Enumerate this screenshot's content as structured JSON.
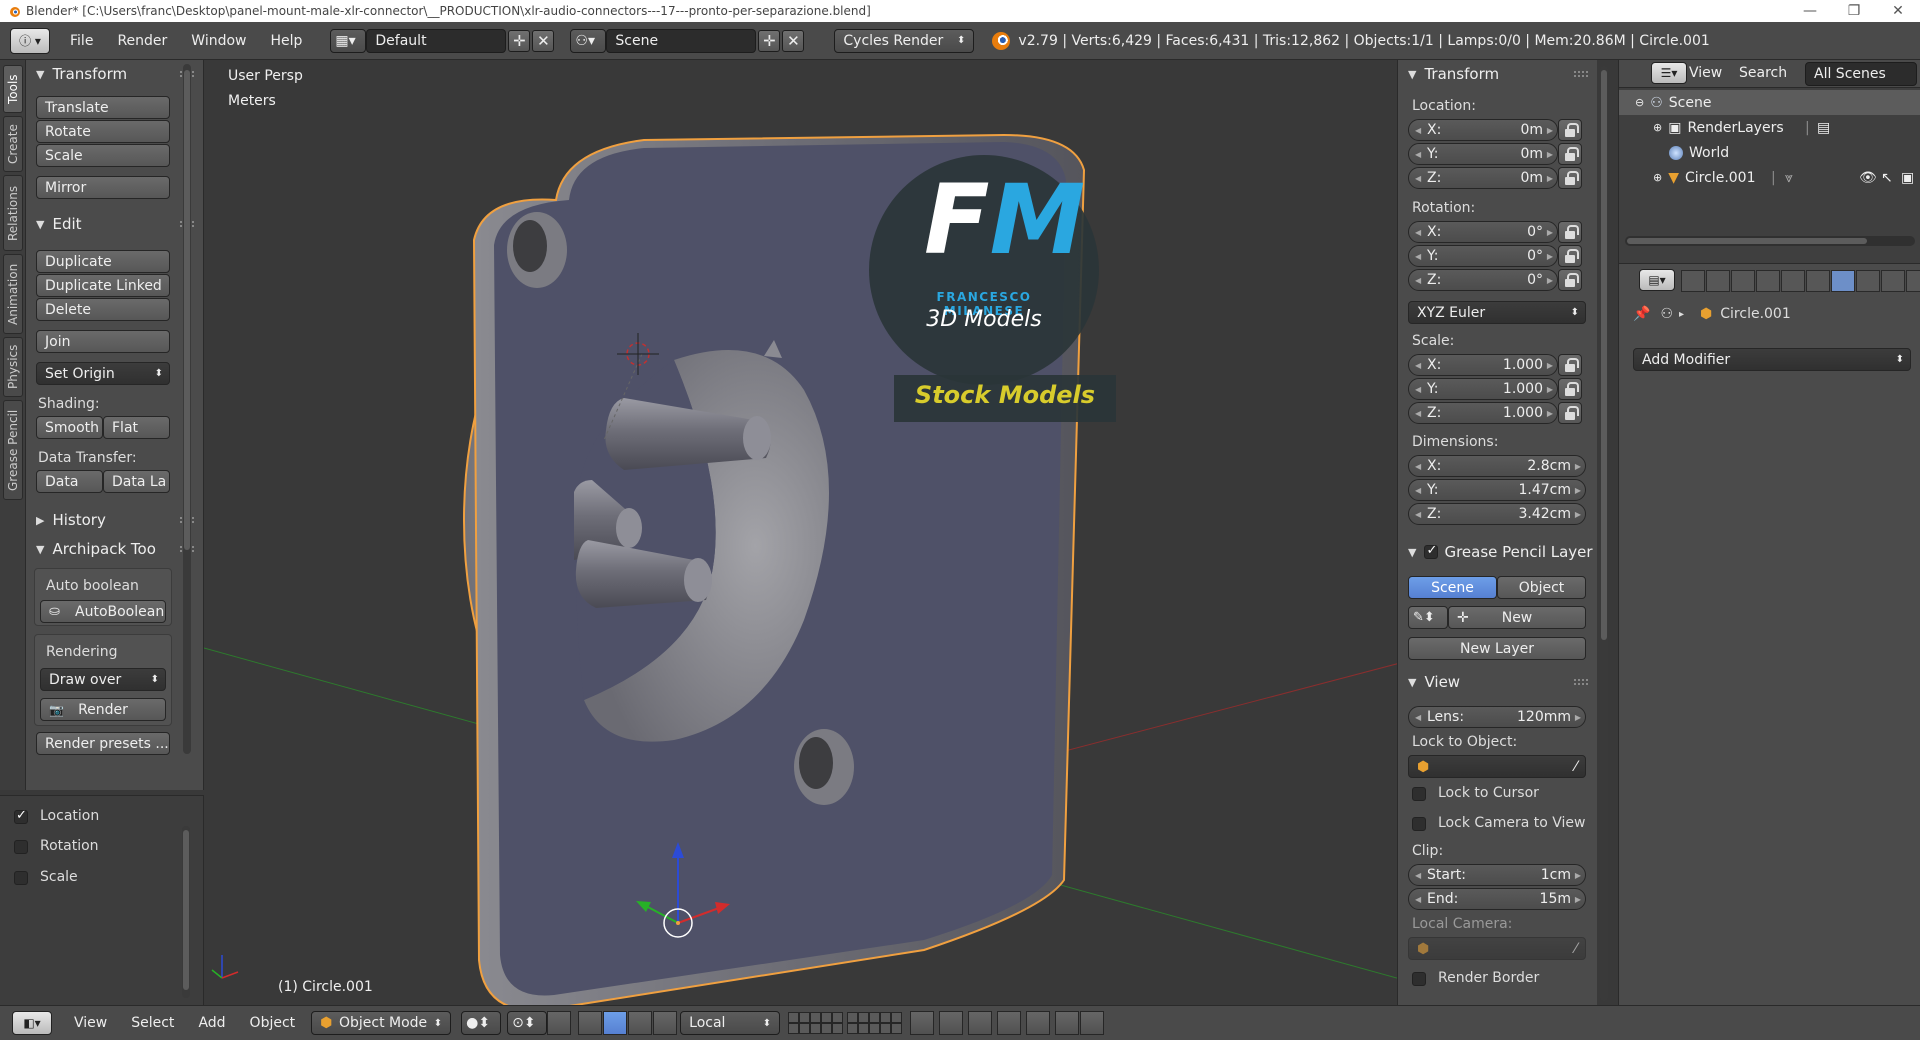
{
  "window": {
    "title": "Blender* [C:\\Users\\franc\\Desktop\\panel-mount-male-xlr-connector\\__PRODUCTION\\xlr-audio-connectors---17---pronto-per-separazione.blend]",
    "minimize": "—",
    "restore": "❐",
    "close": "✕"
  },
  "info_header": {
    "editor_icon": "info-icon",
    "menus": [
      "File",
      "Render",
      "Window",
      "Help"
    ],
    "screen_layout": "Default",
    "scene": "Scene",
    "render_engine": "Cycles Render",
    "stats": "v2.79 | Verts:6,429 | Faces:6,431 | Tris:12,862 | Objects:1/1 | Lamps:0/0 | Mem:20.86M | Circle.001"
  },
  "left_tabs": [
    "Tools",
    "Create",
    "Relations",
    "Animation",
    "Physics",
    "Grease Pencil"
  ],
  "tool_shelf": {
    "transform": {
      "title": "Transform",
      "buttons": [
        "Translate",
        "Rotate",
        "Scale",
        "Mirror"
      ]
    },
    "edit": {
      "title": "Edit",
      "buttons": [
        "Duplicate",
        "Duplicate Linked",
        "Delete",
        "Join"
      ],
      "set_origin": "Set Origin",
      "shading_label": "Shading:",
      "smooth": "Smooth",
      "flat": "Flat",
      "data_transfer_label": "Data Transfer:",
      "data": "Data",
      "data_layers": "Data La"
    },
    "history": {
      "title": "History"
    },
    "archipack": {
      "title": "Archipack Too",
      "auto_boolean_label": "Auto boolean",
      "auto_boolean_button": "AutoBoolean",
      "rendering_label": "Rendering",
      "draw_over": "Draw over",
      "render_button": "Render",
      "render_presets": "Render presets ..."
    }
  },
  "last_operator": {
    "items": [
      {
        "label": "Location",
        "checked": true
      },
      {
        "label": "Rotation",
        "checked": false
      },
      {
        "label": "Scale",
        "checked": false
      }
    ]
  },
  "viewport": {
    "view_name": "User Persp",
    "units": "Meters",
    "object_info": "(1) Circle.001",
    "watermark": {
      "monogram_f": "F",
      "monogram_m": "M",
      "brand": "FRANCESCO MILANESE",
      "tagline": "3D Models",
      "banner": "Stock Models"
    }
  },
  "n_panel": {
    "transform_title": "Transform",
    "location_label": "Location:",
    "location": [
      {
        "axis": "X:",
        "value": "0m"
      },
      {
        "axis": "Y:",
        "value": "0m"
      },
      {
        "axis": "Z:",
        "value": "0m"
      }
    ],
    "rotation_label": "Rotation:",
    "rotation": [
      {
        "axis": "X:",
        "value": "0°"
      },
      {
        "axis": "Y:",
        "value": "0°"
      },
      {
        "axis": "Z:",
        "value": "0°"
      }
    ],
    "rotation_mode": "XYZ Euler",
    "scale_label": "Scale:",
    "scale": [
      {
        "axis": "X:",
        "value": "1.000"
      },
      {
        "axis": "Y:",
        "value": "1.000"
      },
      {
        "axis": "Z:",
        "value": "1.000"
      }
    ],
    "dimensions_label": "Dimensions:",
    "dimensions": [
      {
        "axis": "X:",
        "value": "2.8cm"
      },
      {
        "axis": "Y:",
        "value": "1.47cm"
      },
      {
        "axis": "Z:",
        "value": "3.42cm"
      }
    ],
    "grease_pencil_title": "Grease Pencil Layer",
    "gp_scene": "Scene",
    "gp_object": "Object",
    "gp_new": "New",
    "gp_new_layer": "New Layer",
    "view_title": "View",
    "lens_label": "Lens:",
    "lens_value": "120mm",
    "lock_to_object_label": "Lock to Object:",
    "lock_to_cursor": "Lock to Cursor",
    "lock_camera_to_view": "Lock Camera to View",
    "clip_label": "Clip:",
    "clip_start_label": "Start:",
    "clip_start_value": "1cm",
    "clip_end_label": "End:",
    "clip_end_value": "15m",
    "local_camera_label": "Local Camera:",
    "render_border": "Render Border"
  },
  "outliner": {
    "menus": [
      "View",
      "Search"
    ],
    "display_mode": "All Scenes",
    "rows": [
      {
        "label": "Scene",
        "icon": "scene-icon"
      },
      {
        "label": "RenderLayers",
        "icon": "renderlayers-icon"
      },
      {
        "label": "World",
        "icon": "world-icon"
      },
      {
        "label": "Circle.001",
        "icon": "mesh-object-icon"
      }
    ]
  },
  "properties": {
    "object_name": "Circle.001",
    "add_modifier": "Add Modifier"
  },
  "view3d_header": {
    "menus": [
      "View",
      "Select",
      "Add",
      "Object"
    ],
    "mode": "Object Mode",
    "orientation": "Local"
  },
  "colors": {
    "selection_outline": "#f0a040",
    "active_blue": "#5680d2",
    "watermark_cyan": "#2aa7e0",
    "watermark_yellow": "#d8cc2c"
  }
}
